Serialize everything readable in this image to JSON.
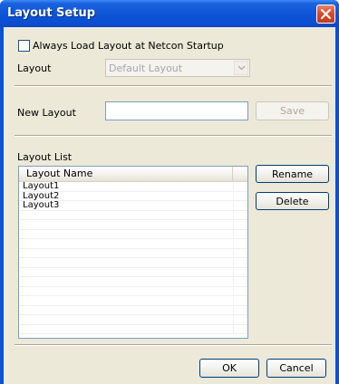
{
  "window": {
    "title": "Layout Setup"
  },
  "always_load": {
    "label": "Always Load Layout at Netcon Startup",
    "checked": false
  },
  "layout": {
    "label": "Layout",
    "value": "Default Layout"
  },
  "new_layout": {
    "label": "New Layout",
    "value": "",
    "save_label": "Save"
  },
  "layout_list": {
    "label": "Layout List",
    "column_header": "Layout Name",
    "rows": [
      "Layout1",
      "Layout2",
      "Layout3",
      "",
      "",
      "",
      "",
      "",
      "",
      "",
      "",
      "",
      "",
      "",
      "",
      ""
    ],
    "rename_label": "Rename",
    "delete_label": "Delete"
  },
  "footer": {
    "ok_label": "OK",
    "cancel_label": "Cancel"
  },
  "colors": {
    "titlebar": "#0a50d8",
    "client": "#ece9d8",
    "close": "#d64d2c"
  }
}
